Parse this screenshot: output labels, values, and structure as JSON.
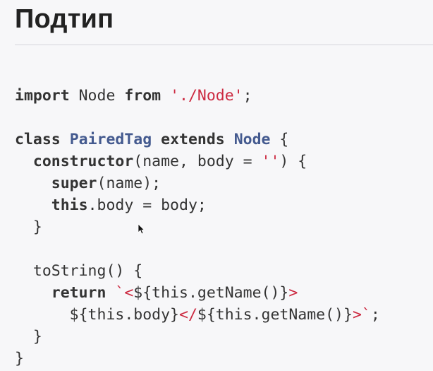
{
  "page": {
    "title": "Подтип"
  },
  "code": {
    "lines": [
      [
        {
          "t": "kw",
          "v": "import"
        },
        {
          "t": "plain",
          "v": " Node "
        },
        {
          "t": "kw",
          "v": "from"
        },
        {
          "t": "plain",
          "v": " "
        },
        {
          "t": "str",
          "v": "'./Node'"
        },
        {
          "t": "plain",
          "v": ";"
        }
      ],
      [],
      [
        {
          "t": "kw",
          "v": "class"
        },
        {
          "t": "plain",
          "v": " "
        },
        {
          "t": "class",
          "v": "PairedTag"
        },
        {
          "t": "plain",
          "v": " "
        },
        {
          "t": "kw",
          "v": "extends"
        },
        {
          "t": "plain",
          "v": " "
        },
        {
          "t": "class",
          "v": "Node"
        },
        {
          "t": "plain",
          "v": " {"
        }
      ],
      [
        {
          "t": "plain",
          "v": "  "
        },
        {
          "t": "kw",
          "v": "constructor"
        },
        {
          "t": "plain",
          "v": "(name, body = "
        },
        {
          "t": "str",
          "v": "''"
        },
        {
          "t": "plain",
          "v": ") {"
        }
      ],
      [
        {
          "t": "plain",
          "v": "    "
        },
        {
          "t": "kw",
          "v": "super"
        },
        {
          "t": "plain",
          "v": "(name);"
        }
      ],
      [
        {
          "t": "plain",
          "v": "    "
        },
        {
          "t": "kw",
          "v": "this"
        },
        {
          "t": "plain",
          "v": ".body = body;"
        }
      ],
      [
        {
          "t": "plain",
          "v": "  }"
        }
      ],
      [],
      [
        {
          "t": "plain",
          "v": "  toString() {"
        }
      ],
      [
        {
          "t": "plain",
          "v": "    "
        },
        {
          "t": "kw",
          "v": "return"
        },
        {
          "t": "plain",
          "v": " "
        },
        {
          "t": "str",
          "v": "`<"
        },
        {
          "t": "plain",
          "v": "${this.getName()}"
        },
        {
          "t": "str",
          "v": ">"
        }
      ],
      [
        {
          "t": "plain",
          "v": "      ${this.body}"
        },
        {
          "t": "str",
          "v": "</"
        },
        {
          "t": "plain",
          "v": "${this.getName()}"
        },
        {
          "t": "str",
          "v": ">`"
        },
        {
          "t": "plain",
          "v": ";"
        }
      ],
      [
        {
          "t": "plain",
          "v": "  }"
        }
      ],
      [
        {
          "t": "plain",
          "v": "}"
        }
      ]
    ]
  },
  "icons": {
    "cursor": "mouse-pointer-icon"
  },
  "colors": {
    "background": "#f7f7f9",
    "text": "#333333",
    "keyword": "#333333",
    "class_name": "#445a8f",
    "string": "#cc2a41",
    "divider": "#d6d6db"
  }
}
